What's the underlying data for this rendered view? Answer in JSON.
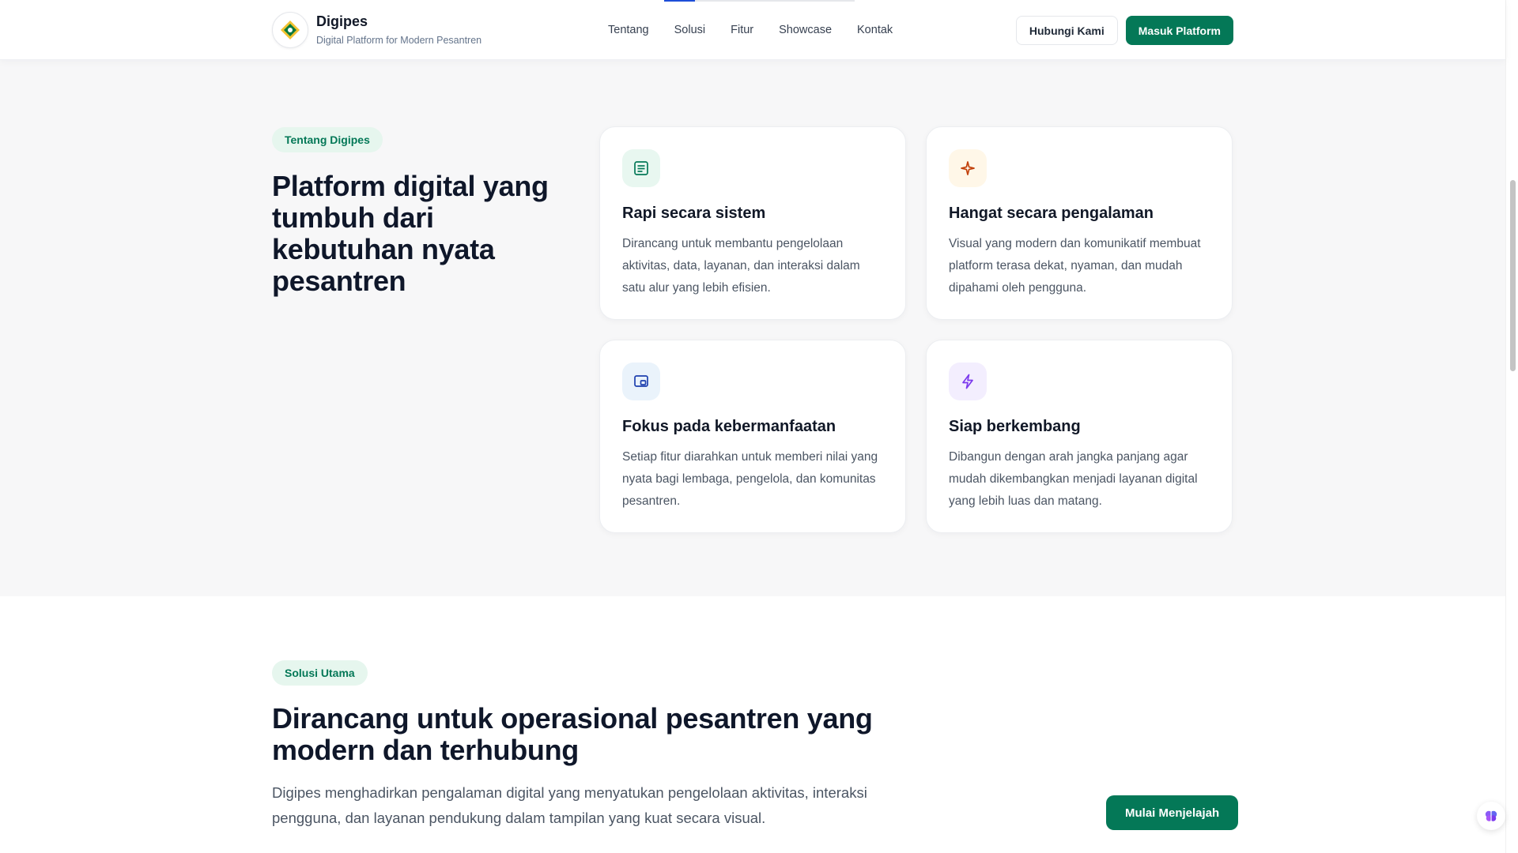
{
  "brand": {
    "name": "Digipes",
    "tagline": "Digital Platform for Modern Pesantren"
  },
  "nav": {
    "items": [
      "Tentang",
      "Solusi",
      "Fitur",
      "Showcase",
      "Kontak"
    ],
    "scroll_progress": 0.16
  },
  "header_actions": {
    "contact_label": "Hubungi Kami",
    "login_label": "Masuk Platform"
  },
  "about": {
    "pill": "Tentang Digipes",
    "title": "Platform digital yang tumbuh dari kebutuhan nyata pesantren",
    "cards": [
      {
        "icon": "document-list-icon",
        "accent": "#047857",
        "icon_bg": "#e8f7f0",
        "title": "Rapi secara sistem",
        "desc": "Dirancang untuk membantu pengelolaan aktivitas, data, layanan, dan interaksi dalam satu alur yang lebih efisien."
      },
      {
        "icon": "sparkle-icon",
        "accent": "#c2410c",
        "icon_bg": "#fff7e8",
        "title": "Hangat secara pengalaman",
        "desc": "Visual yang modern dan komunikatif membuat platform terasa dekat, nyaman, dan mudah dipahami oleh pengguna."
      },
      {
        "icon": "monitor-icon",
        "accent": "#1e40af",
        "icon_bg": "#eaf3fb",
        "title": "Fokus pada kebermanfaatan",
        "desc": "Setiap fitur diarahkan untuk memberi nilai yang nyata bagi lembaga, pengelola, dan komunitas pesantren."
      },
      {
        "icon": "lightning-icon",
        "accent": "#7c3aed",
        "icon_bg": "#f3eefe",
        "title": "Siap berkembang",
        "desc": "Dibangun dengan arah jangka panjang agar mudah dikembangkan menjadi layanan digital yang lebih luas dan matang."
      }
    ]
  },
  "solusi": {
    "pill": "Solusi Utama",
    "title": "Dirancang untuk operasional pesantren yang modern dan terhubung",
    "desc": "Digipes menghadirkan pengalaman digital yang menyatukan pengelolaan aktivitas, interaksi pengguna, dan layanan pendukung dalam tampilan yang kuat secara visual.",
    "cta_label": "Mulai Menjelajah"
  },
  "colors": {
    "primary": "#047857",
    "pill_bg": "#e6f6ee",
    "section_bg": "#f7f7f8"
  }
}
